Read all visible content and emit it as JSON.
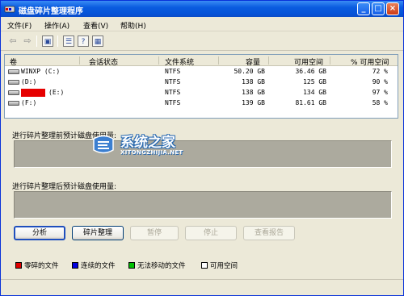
{
  "window": {
    "title": "磁盘碎片整理程序"
  },
  "title_buttons": {
    "minimize": "_",
    "maximize": "□",
    "close": "×"
  },
  "menu": [
    "文件(F)",
    "操作(A)",
    "查看(V)",
    "帮助(H)"
  ],
  "toolbar": {
    "icons": [
      "back-arrow-icon",
      "forward-arrow-icon",
      "console-tree-icon",
      "properties-icon",
      "help-icon",
      "refresh-icon"
    ],
    "glyphs": {
      "back": "⇦",
      "forward": "⇨",
      "console": "▣",
      "properties": "☰",
      "help": "?",
      "refresh": "▦"
    }
  },
  "volume_list": {
    "headers": [
      "卷",
      "会话状态",
      "文件系统",
      "容量",
      "可用空间",
      "% 可用空间"
    ],
    "rows": [
      {
        "volume": "WINXP (C:)",
        "status": "",
        "fs": "NTFS",
        "capacity": "50.20 GB",
        "free": "36.46 GB",
        "pct": "72 %"
      },
      {
        "volume": "(D:)",
        "status": "",
        "fs": "NTFS",
        "capacity": "138 GB",
        "free": "125 GB",
        "pct": "90 %"
      },
      {
        "volume": "(E:)",
        "status": "",
        "fs": "NTFS",
        "capacity": "138 GB",
        "free": "134 GB",
        "pct": "97 %",
        "redacted_label": true
      },
      {
        "volume": "(F:)",
        "status": "",
        "fs": "NTFS",
        "capacity": "139 GB",
        "free": "81.61 GB",
        "pct": "58 %"
      }
    ]
  },
  "usage": {
    "before_label": "进行碎片整理前预计磁盘使用量:",
    "after_label": "进行碎片整理后预计磁盘使用量:"
  },
  "buttons": {
    "analyze": "分析",
    "defrag": "碎片整理",
    "pause": "暂停",
    "stop": "停止",
    "report": "查看报告"
  },
  "legend": [
    {
      "label": "零碎的文件",
      "color": "#e00000"
    },
    {
      "label": "连续的文件",
      "color": "#0000e0"
    },
    {
      "label": "无法移动的文件",
      "color": "#00c000"
    },
    {
      "label": "可用空间",
      "color": "#ffffff"
    }
  ],
  "watermark": {
    "cn": "系统之家",
    "en": "XITONGZHIJIA.NET"
  }
}
